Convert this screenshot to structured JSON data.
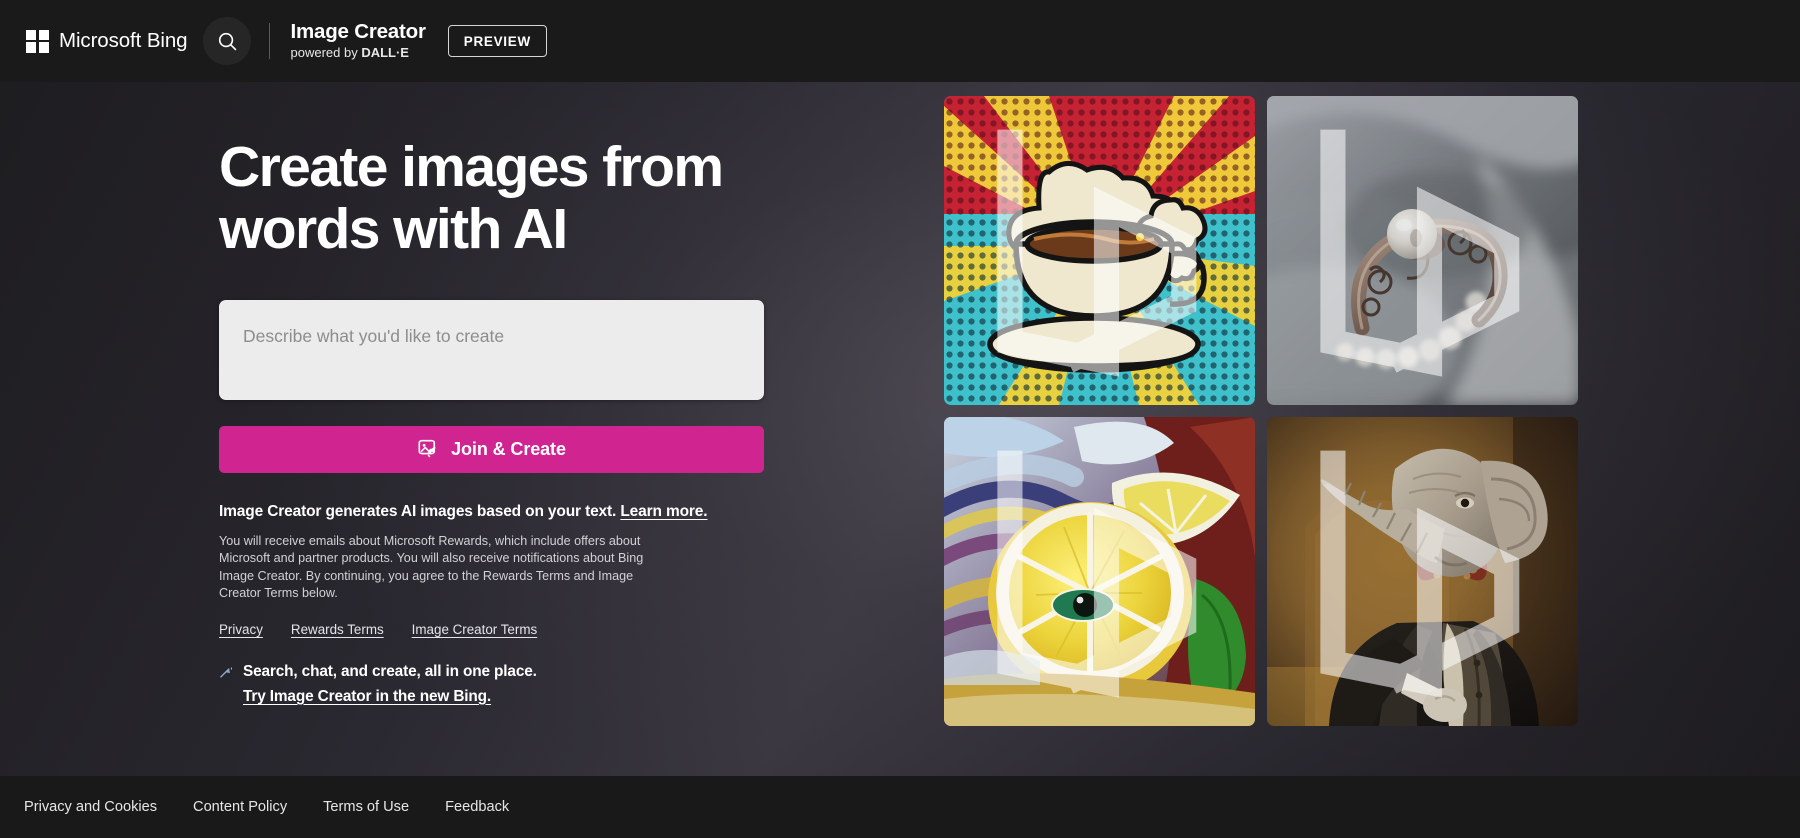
{
  "header": {
    "brand_name": "Microsoft Bing",
    "search_icon": "search-icon",
    "product_title": "Image Creator",
    "product_sub_prefix": "powered by ",
    "product_sub_brand": "DALL·E",
    "preview_label": "PREVIEW"
  },
  "hero": {
    "headline": "Create images from\nwords with AI",
    "prompt_placeholder": "Describe what you'd like to create",
    "prompt_value": "",
    "cta_label": "Join & Create",
    "cta_icon": "image-wand-icon",
    "cta_color": "#d02490"
  },
  "legal": {
    "headline_text": "Image Creator generates AI images based on your text. ",
    "headline_link": "Learn more.",
    "body": "You will receive emails about Microsoft Rewards, which include offers about Microsoft and partner products. You will also receive notifications about Bing Image Creator. By continuing, you agree to the Rewards Terms and Image Creator Terms below.",
    "links": [
      {
        "label": "Privacy"
      },
      {
        "label": "Rewards Terms"
      },
      {
        "label": "Image Creator Terms"
      }
    ]
  },
  "callout": {
    "icon": "bing-chat-sparkle-icon",
    "line1": "Search, chat, and create, all in one place.",
    "line2": "Try Image Creator in the new Bing."
  },
  "gallery": {
    "tiles": [
      {
        "name": "pop-art-coffee-cup",
        "alt": "Pop art comic style coffee cup with steam on halftone teal, red and yellow rays background"
      },
      {
        "name": "pearl-ring-photo",
        "alt": "Close-up photo of an ornate silver filigree ring with a pearl resting on soft gray fabric with pearls"
      },
      {
        "name": "surreal-lemon-painting",
        "alt": "Surreal oil painting of a lemon slice with an eye, swirling blue purple and red background with green leaf"
      },
      {
        "name": "elephant-gentleman-portrait",
        "alt": "Painted portrait of an elephant wearing a tuxedo and bow tie in a warm golden interior"
      }
    ]
  },
  "footer": {
    "links": [
      {
        "label": "Privacy and Cookies"
      },
      {
        "label": "Content Policy"
      },
      {
        "label": "Terms of Use"
      },
      {
        "label": "Feedback"
      }
    ]
  }
}
